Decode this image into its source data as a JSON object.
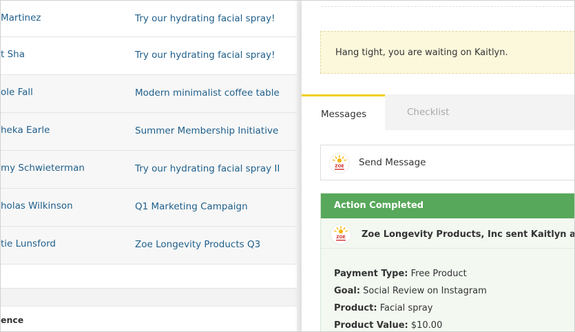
{
  "list": {
    "rows": [
      {
        "name": "Martinez",
        "campaign": "Try our hydrating facial spray!"
      },
      {
        "name": "t Sha",
        "campaign": "Try our hydrating facial spray!"
      },
      {
        "name": "ole Fall",
        "campaign": "Modern minimalist coffee table"
      },
      {
        "name": "heka Earle",
        "campaign": "Summer Membership Initiative"
      },
      {
        "name": "my Schwieterman",
        "campaign": "Try our hydrating facial spray II"
      },
      {
        "name": "holas Wilkinson",
        "campaign": "Q1 Marketing Campaign"
      },
      {
        "name": "tie Lunsford",
        "campaign": "Zoe Longevity Products Q3"
      }
    ],
    "footer_label": "ence"
  },
  "detail": {
    "notice": "Hang tight, you are waiting on Kaitlyn.",
    "tabs": {
      "messages": "Messages",
      "checklist": "Checklist"
    },
    "send_message": "Send Message",
    "logo_text": "ZOE",
    "action": {
      "header": "Action Completed",
      "sender_text": "Zoe Longevity Products, Inc sent Kaitlyn a pitch",
      "fields": [
        {
          "label": "Payment Type:",
          "value": " Free Product"
        },
        {
          "label": "Goal:",
          "value": " Social Review on Instagram"
        },
        {
          "label": "Product:",
          "value": " Facial spray"
        },
        {
          "label": "Product Value:",
          "value": " $10.00"
        }
      ]
    }
  },
  "colors": {
    "link": "#1f5f8b",
    "success": "#57a85a",
    "tab_accent": "#f0cf1e",
    "notice_bg": "#fcf8dc"
  }
}
